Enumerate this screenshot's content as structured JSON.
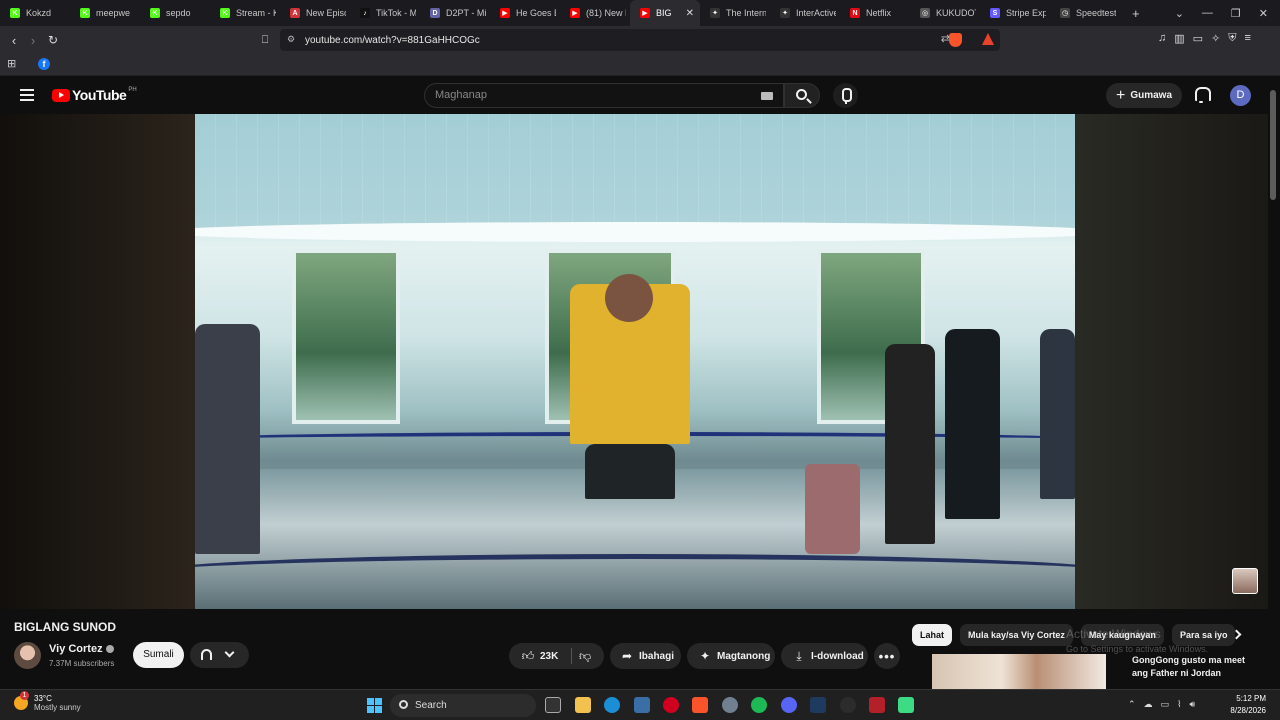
{
  "browser": {
    "tabs": [
      {
        "title": "Kokzd",
        "fav_color": "#53fc18",
        "fav_letter": "K"
      },
      {
        "title": "meepwe",
        "fav_color": "#53fc18",
        "fav_letter": "K"
      },
      {
        "title": "sepdo",
        "fav_color": "#53fc18",
        "fav_letter": "K"
      },
      {
        "title": "Stream - K",
        "fav_color": "#53fc18",
        "fav_letter": "K"
      },
      {
        "title": "New Episo",
        "fav_color": "#d13438",
        "fav_letter": "A"
      },
      {
        "title": "TikTok - M",
        "fav_color": "#111111",
        "fav_letter": "♪"
      },
      {
        "title": "D2PT - Mi",
        "fav_color": "#6264a7",
        "fav_letter": "D"
      },
      {
        "title": "He Goes B",
        "fav_color": "#ff0000",
        "fav_letter": "▶"
      },
      {
        "title": "(81) New F",
        "fav_color": "#ff0000",
        "fav_letter": "▶"
      },
      {
        "title": "BIG",
        "fav_color": "#ff0000",
        "fav_letter": "▶",
        "active": true
      },
      {
        "title": "The Intern",
        "fav_color": "#333333",
        "fav_letter": "✦"
      },
      {
        "title": "InterActive",
        "fav_color": "#333333",
        "fav_letter": "✦"
      },
      {
        "title": "Netflix",
        "fav_color": "#e50914",
        "fav_letter": "N"
      },
      {
        "title": "KUKUDOT",
        "fav_color": "#555555",
        "fav_letter": "◎"
      },
      {
        "title": "Stripe Exp",
        "fav_color": "#635bff",
        "fav_letter": "S"
      },
      {
        "title": "Speedtest",
        "fav_color": "#444444",
        "fav_letter": "◷"
      }
    ],
    "new_tab": "+",
    "url": "youtube.com/watch?v=881GaHHCOGc"
  },
  "youtube": {
    "logo_text": "YouTube",
    "country": "PH",
    "search_placeholder": "Maghanap",
    "create_label": "Gumawa",
    "avatar_letter": "D"
  },
  "video": {
    "title": "BIGLANG SUNOD",
    "channel": "Viy Cortez",
    "subscribers": "7.37M subscribers",
    "join_label": "Sumali",
    "likes": "23K",
    "share_label": "Ibahagi",
    "ask_label": "Magtanong",
    "download_label": "I-download",
    "more_label": "•••"
  },
  "sidebar": {
    "chips": [
      "Lahat",
      "Mula kay/sa Viy Cortez",
      "May kaugnayan",
      "Para sa iyo"
    ],
    "recommended_title": "GongGong gusto ma meet ang Father ni Jordan"
  },
  "watermark": {
    "line1": "Activate Windows",
    "line2": "Go to Settings to activate Windows."
  },
  "taskbar": {
    "temp": "33°C",
    "weather": "Mostly sunny",
    "weather_badge": "1",
    "search_label": "Search",
    "time": "5:12 PM",
    "date": "8/28/2026"
  }
}
